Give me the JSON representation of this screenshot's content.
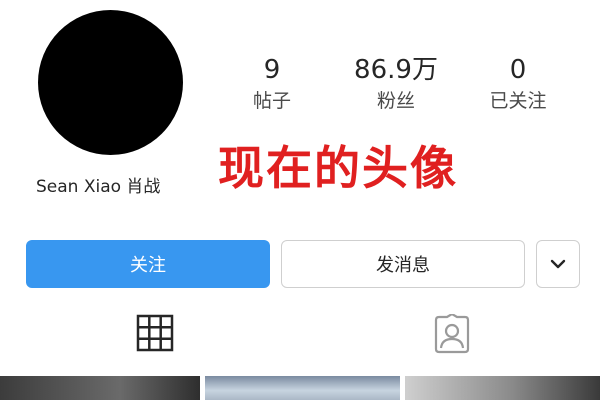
{
  "profile": {
    "name": "Sean Xiao 肖战",
    "stats": [
      {
        "value": "9",
        "label": "帖子"
      },
      {
        "value": "86.9万",
        "label": "粉丝"
      },
      {
        "value": "0",
        "label": "已关注"
      }
    ]
  },
  "overlay_caption": "现在的头像",
  "actions": {
    "follow_label": "关注",
    "message_label": "发消息",
    "more_icon": "chevron-down-icon"
  },
  "tabs": [
    {
      "icon": "grid-icon"
    },
    {
      "icon": "tagged-person-icon"
    }
  ],
  "colors": {
    "follow_button": "#3897f0",
    "overlay_text": "#e02020",
    "avatar": "#000000"
  }
}
